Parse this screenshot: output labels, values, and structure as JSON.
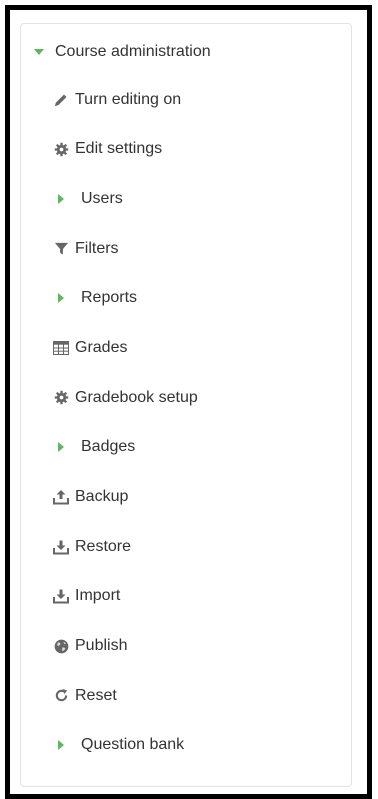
{
  "menu": {
    "title": "Course administration",
    "items": [
      {
        "label": "Turn editing on",
        "icon": "pencil-icon"
      },
      {
        "label": "Edit settings",
        "icon": "gear-icon"
      },
      {
        "label": "Users",
        "icon": "expand-caret-icon"
      },
      {
        "label": "Filters",
        "icon": "filter-icon"
      },
      {
        "label": "Reports",
        "icon": "expand-caret-icon"
      },
      {
        "label": "Grades",
        "icon": "table-icon"
      },
      {
        "label": "Gradebook setup",
        "icon": "gear-icon"
      },
      {
        "label": "Badges",
        "icon": "expand-caret-icon"
      },
      {
        "label": "Backup",
        "icon": "upload-icon"
      },
      {
        "label": "Restore",
        "icon": "download-icon"
      },
      {
        "label": "Import",
        "icon": "download-icon"
      },
      {
        "label": "Publish",
        "icon": "globe-icon"
      },
      {
        "label": "Reset",
        "icon": "refresh-icon"
      },
      {
        "label": "Question bank",
        "icon": "expand-caret-icon"
      }
    ]
  },
  "colors": {
    "text": "#333333",
    "icon": "#666666",
    "accent": "#5cb85c",
    "border": "#000000"
  }
}
